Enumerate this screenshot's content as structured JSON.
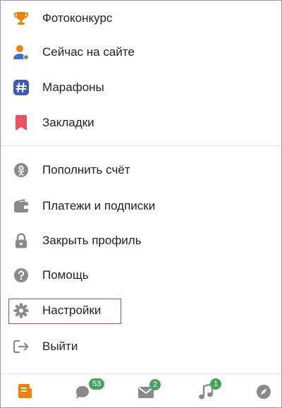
{
  "menu": {
    "items": [
      {
        "label": "Фотоконкурс",
        "icon": "trophy-icon"
      },
      {
        "label": "Сейчас на сайте",
        "icon": "online-user-icon"
      },
      {
        "label": "Марафоны",
        "icon": "hashtag-icon"
      },
      {
        "label": "Закладки",
        "icon": "bookmark-icon"
      },
      {
        "label": "Пополнить счёт",
        "icon": "ok-coin-icon"
      },
      {
        "label": "Платежи и подписки",
        "icon": "wallet-icon"
      },
      {
        "label": "Закрыть профиль",
        "icon": "lock-icon"
      },
      {
        "label": "Помощь",
        "icon": "help-icon"
      },
      {
        "label": "Настройки",
        "icon": "gear-icon"
      },
      {
        "label": "Выйти",
        "icon": "logout-icon"
      }
    ]
  },
  "bottom_nav": {
    "messages_badge": "53",
    "notifications_badge": "2",
    "music_badge": "1"
  },
  "colors": {
    "accent_orange": "#ee8208",
    "badge_green": "#46a35e",
    "highlight_red": "#c9474a",
    "icon_gray": "#8a8a8a"
  }
}
